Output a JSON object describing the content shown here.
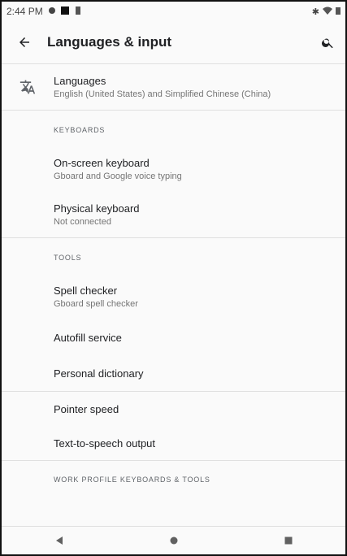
{
  "status_bar": {
    "time": "2:44 PM",
    "icons": [
      "google-icon",
      "media-icon",
      "sim-icon"
    ],
    "right_icons": [
      "bluetooth-icon",
      "wifi-icon",
      "battery-icon"
    ]
  },
  "app_bar": {
    "title": "Languages & input"
  },
  "items": {
    "languages": {
      "title": "Languages",
      "subtitle": "English (United States) and Simplified Chinese (China)"
    },
    "keyboards_header": "KEYBOARDS",
    "onscreen": {
      "title": "On-screen keyboard",
      "subtitle": "Gboard and Google voice typing"
    },
    "physical": {
      "title": "Physical keyboard",
      "subtitle": "Not connected"
    },
    "tools_header": "TOOLS",
    "spell": {
      "title": "Spell checker",
      "subtitle": "Gboard spell checker"
    },
    "autofill": {
      "title": "Autofill service"
    },
    "dictionary": {
      "title": "Personal dictionary"
    },
    "pointer": {
      "title": "Pointer speed"
    },
    "tts": {
      "title": "Text-to-speech output"
    },
    "work_header": "WORK PROFILE KEYBOARDS & TOOLS"
  },
  "nav": {
    "back_icon": "back-triangle",
    "home_icon": "home-circle",
    "recents_icon": "recents-square"
  }
}
